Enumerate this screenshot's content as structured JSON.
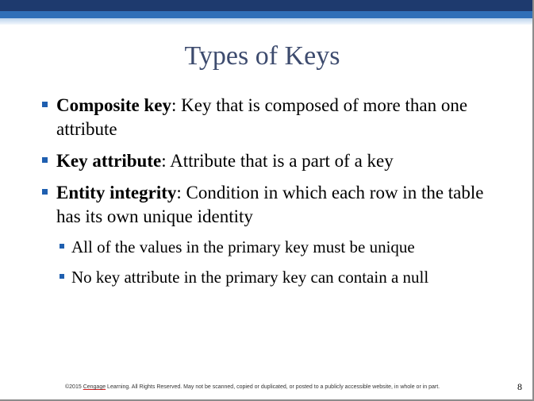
{
  "slide": {
    "title": "Types of Keys",
    "bullets": [
      {
        "term": "Composite key",
        "text": ": Key that is composed of more than one attribute"
      },
      {
        "term": "Key attribute",
        "text": ": Attribute that is a part of a key"
      },
      {
        "term": "Entity integrity",
        "text": ": Condition in which each row in the table has its own unique identity",
        "sub_bullets": [
          "All of the values in the primary key must be unique",
          "No key attribute in the primary key can contain a null"
        ]
      }
    ],
    "footer": {
      "prefix": "©2015 ",
      "brand": "Cengage",
      "suffix": " Learning. All Rights Reserved. May not be scanned, copied or duplicated, or posted to a publicly accessible website, in whole or in part."
    },
    "page_number": "8"
  },
  "colors": {
    "header_dark": "#1e3a6e",
    "header_mid": "#2f6fb8",
    "title_text": "#3d4b6e",
    "bullet": "#1f5fb0"
  }
}
